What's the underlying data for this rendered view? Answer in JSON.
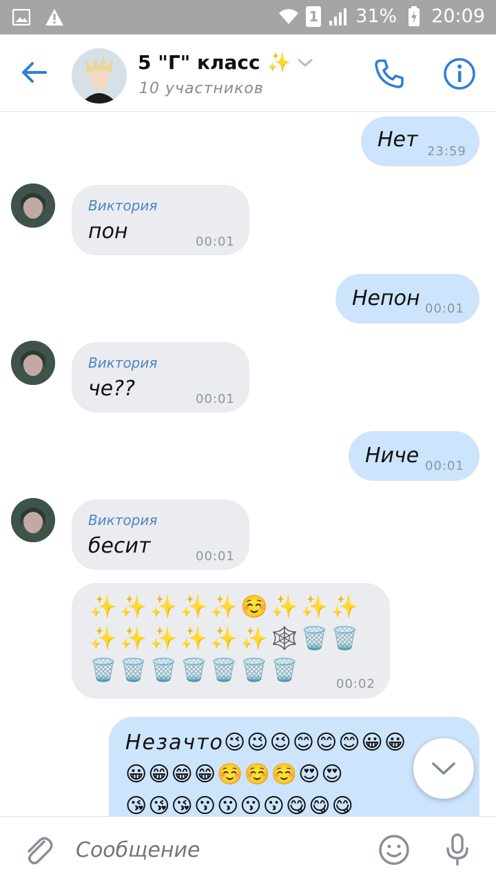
{
  "status_bar": {
    "sim": "1",
    "battery": "31%",
    "time": "20:09",
    "icons": [
      "gallery-icon",
      "warning-icon",
      "wifi-icon",
      "signal-icon",
      "battery-charging-icon"
    ]
  },
  "header": {
    "title": "5 \"Г\" класс",
    "title_emoji": "✨",
    "subtitle": "10 участников",
    "accent_color": "#2b7fd8"
  },
  "messages": [
    {
      "direction": "out",
      "text": "Нет",
      "time": "23:59"
    },
    {
      "direction": "in",
      "sender": "Виктория",
      "text": "пон",
      "time": "00:01"
    },
    {
      "direction": "out",
      "text": "Непон",
      "time": "00:01"
    },
    {
      "direction": "in",
      "sender": "Виктория",
      "text": "че??",
      "time": "00:01"
    },
    {
      "direction": "out",
      "text": "Ниче",
      "time": "00:01"
    },
    {
      "direction": "in",
      "sender": "Виктория",
      "text": "бесит",
      "time": "00:01"
    },
    {
      "direction": "in",
      "lines": [
        "✨✨✨✨✨☺️✨✨✨",
        "✨✨✨✨✨✨🕸️🗑️🗑️",
        "🗑️🗑️🗑️🗑️🗑️🗑️🗑️"
      ],
      "time": "00:02"
    },
    {
      "direction": "out",
      "lines": [
        "Незачто😉😉😉😊😊😊😀😀",
        "😀😁😁😁☺️☺️☺️😍😍",
        "😘😘😘😗😗😗😗😋😋😋"
      ]
    }
  ],
  "composer": {
    "placeholder": "Сообщение"
  },
  "colors": {
    "outgoing_bubble": "#cce4fc",
    "incoming_bubble": "#ebecf0",
    "sender_name": "#4a86c5"
  }
}
